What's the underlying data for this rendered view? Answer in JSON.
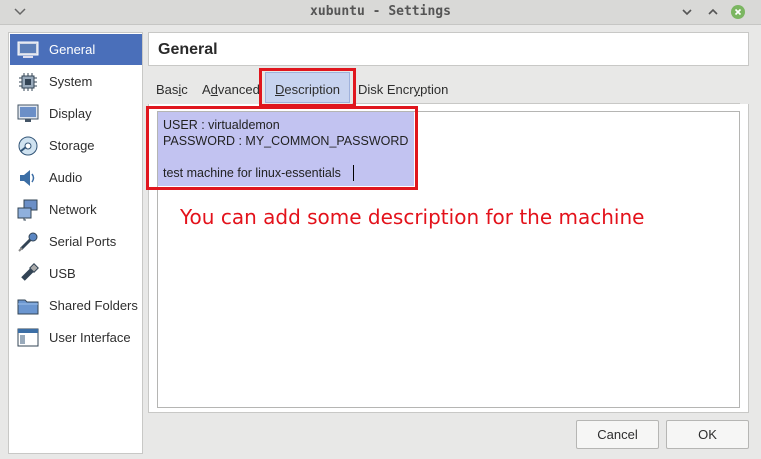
{
  "window": {
    "title": "xubuntu - Settings"
  },
  "header": {
    "title": "General"
  },
  "sidebar": {
    "items": [
      {
        "label": "General",
        "icon": "general-icon",
        "active": true
      },
      {
        "label": "System",
        "icon": "system-icon"
      },
      {
        "label": "Display",
        "icon": "display-icon"
      },
      {
        "label": "Storage",
        "icon": "storage-icon"
      },
      {
        "label": "Audio",
        "icon": "audio-icon"
      },
      {
        "label": "Network",
        "icon": "network-icon"
      },
      {
        "label": "Serial Ports",
        "icon": "serial-ports-icon"
      },
      {
        "label": "USB",
        "icon": "usb-icon"
      },
      {
        "label": "Shared Folders",
        "icon": "shared-folders-icon"
      },
      {
        "label": "User Interface",
        "icon": "user-interface-icon"
      }
    ]
  },
  "tabs": [
    {
      "pre": "Bas",
      "key": "i",
      "post": "c"
    },
    {
      "pre": "A",
      "key": "d",
      "post": "vanced"
    },
    {
      "pre": "",
      "key": "D",
      "post": "escription",
      "active": true
    },
    {
      "pre": "Disk Encr",
      "key": "y",
      "post": "ption"
    }
  ],
  "description": {
    "lines": [
      "USER : virtualdemon",
      "PASSWORD : MY_COMMON_PASSWORD",
      "",
      "test machine for linux-essentials"
    ]
  },
  "annotation": {
    "text": "You can add some description for the machine",
    "color": "#e3121b"
  },
  "buttons": {
    "cancel": "Cancel",
    "ok": "OK"
  },
  "colors": {
    "accent": "#4a6fba",
    "selection": "#c2c3f1",
    "annotation_border": "#e0161e"
  }
}
